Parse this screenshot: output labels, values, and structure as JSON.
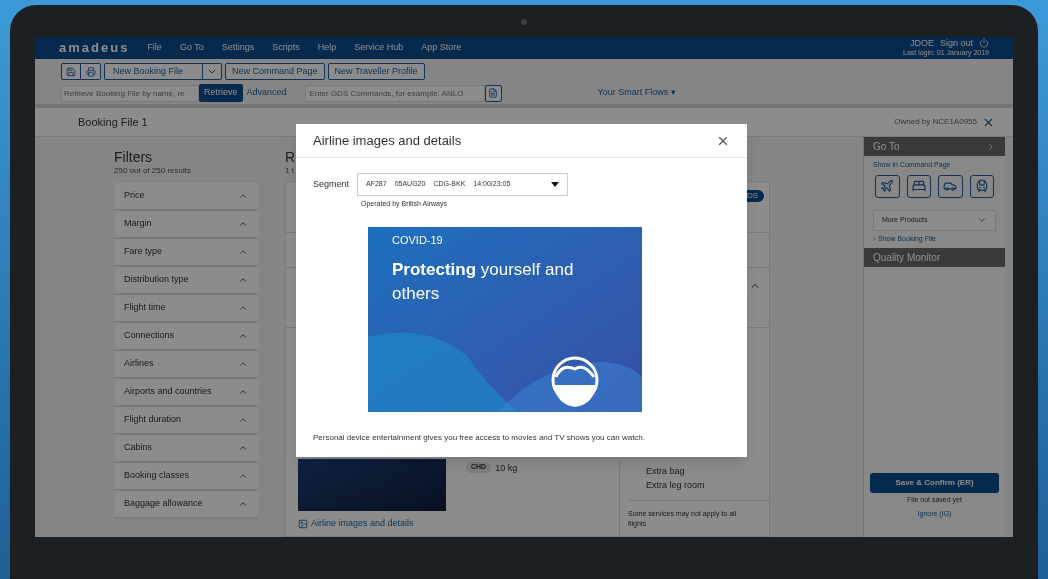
{
  "app": {
    "logo": "amadeus",
    "menu": [
      "File",
      "Go To",
      "Settings",
      "Scripts",
      "Help",
      "Service Hub",
      "App Store"
    ],
    "user": "JDOE",
    "sign_out": "Sign out",
    "last_login": "Last login: 01 January 2019"
  },
  "toolbar": {
    "booking_button": "New Booking File",
    "buttons": [
      "New Command Page",
      "New Traveller Profile"
    ],
    "retrieve_placeholder": "Retrieve Booking File by name, re",
    "retrieve_button": "Retrieve",
    "advanced_link": "Advanced",
    "command_placeholder": "Enter GDS Commands, for example: ANLO",
    "smart_flows": "Your Smart Flows ▾"
  },
  "booking_tab": {
    "title": "Booking File 1",
    "owner": "Owned by NCE1A0955"
  },
  "filters": {
    "title": "Filters",
    "count": "250 out of 250 results",
    "items": [
      "Price",
      "Margin",
      "Fare type",
      "Distribution type",
      "Flight time",
      "Connections",
      "Airlines",
      "Airports and countries",
      "Flight duration",
      "Cabins",
      "Booking classes",
      "Baggage allowance"
    ]
  },
  "results": {
    "title": "R",
    "count": "1 t",
    "badge": "DS",
    "passenger_type": "CHD",
    "baggage": "10 kg",
    "services": [
      "Extra bag",
      "Extra leg room"
    ],
    "note": "Some services may not apply to all flights",
    "images_link": "Airline images and details"
  },
  "side_panel": {
    "goto_title": "Go To",
    "command_page_link": "Show in Command Page",
    "more_products": "More Products",
    "show_booking_link": "Show Booking File",
    "quality_title": "Quality Monitor",
    "save_button": "Save & Confirm (ER)",
    "save_status": "File not saved yet",
    "ignore_link": "Ignore (IG)"
  },
  "modal": {
    "title": "Airline images and details",
    "segment_label": "Segment",
    "segment_parts": [
      "AF287",
      "05AUG20",
      "CDG-BKK",
      "14:00/23:05"
    ],
    "operated_by": "Operated by British Airways",
    "banner": {
      "tag": "COVID-19",
      "headline": "**Protecting** yourself and others"
    },
    "description": "Personal device entertainment gives you free access to movies and TV shows you can watch."
  }
}
